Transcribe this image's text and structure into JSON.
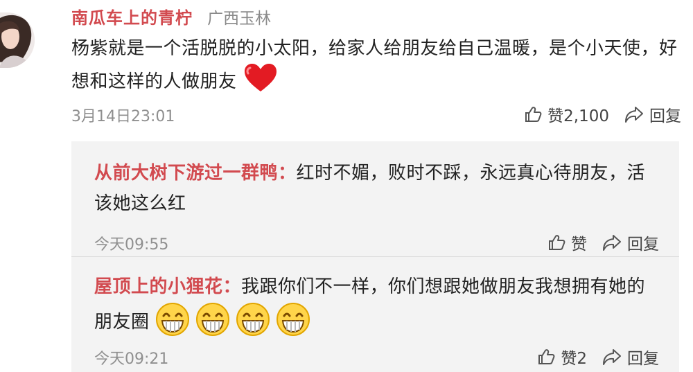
{
  "main_comment": {
    "username": "南瓜车上的青柠",
    "location": "广西玉林",
    "text": "杨紫就是一个活脱脱的小太阳，给家人给朋友给自己温暖，是个小天使，好想和这样的人做朋友",
    "time": "3月14日23:01",
    "like_label": "赞2,100",
    "reply_label": "回复"
  },
  "replies": [
    {
      "username": "从前大树下游过一群鸭",
      "separator": "：",
      "text": "红时不媚，败时不踩，永远真心待朋友，活该她这么红",
      "time": "今天09:55",
      "like_label": "赞",
      "reply_label": "回复"
    },
    {
      "username": "屋顶上的小狸花",
      "separator": "：",
      "text": "我跟你们不一样，你们想跟她做朋友我想拥有她的朋友圈",
      "time": "今天09:21",
      "like_label": "赞2",
      "reply_label": "回复"
    }
  ],
  "icons": {
    "like": "thumbs-up-icon",
    "reply": "share-arrow-icon",
    "heart": "red-heart-emoji",
    "grin": "grinning-emoji"
  },
  "colors": {
    "username": "#d24a4f",
    "meta": "#8f8f8f",
    "reply_background": "#f3f3f3"
  }
}
